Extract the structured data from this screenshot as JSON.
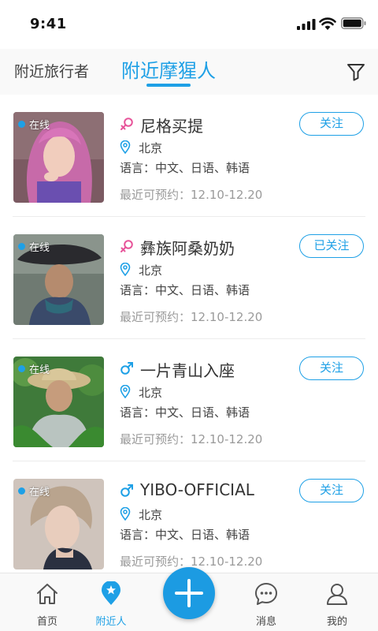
{
  "status_bar": {
    "time": "9:41"
  },
  "top_tabs": {
    "travelers": "附近旅行者",
    "guides": "附近摩猩人"
  },
  "colors": {
    "accent": "#1ea0e6",
    "female": "#e7559a",
    "male": "#1ea0e6"
  },
  "cards": [
    {
      "online": "在线",
      "gender": "female",
      "name": "尼格买提",
      "city": "北京",
      "languages": "语言：中文、日语、韩语",
      "availability": "最近可预约：12.10-12.20",
      "follow": "关注"
    },
    {
      "online": "在线",
      "gender": "female",
      "name": "彝族阿桑奶奶",
      "city": "北京",
      "languages": "语言：中文、日语、韩语",
      "availability": "最近可预约：12.10-12.20",
      "follow": "已关注"
    },
    {
      "online": "在线",
      "gender": "male",
      "name": "一片青山入座",
      "city": "北京",
      "languages": "语言：中文、日语、韩语",
      "availability": "最近可预约：12.10-12.20",
      "follow": "关注"
    },
    {
      "online": "在线",
      "gender": "male",
      "name": "YIBO-OFFICIAL",
      "city": "北京",
      "languages": "语言：中文、日语、韩语",
      "availability": "最近可预约：12.10-12.20",
      "follow": "关注"
    }
  ],
  "bottom_nav": {
    "home": "首页",
    "nearby": "附近人",
    "messages": "消息",
    "mine": "我的"
  },
  "icons": {
    "filter": "filter-icon",
    "location": "location-pin-icon",
    "female": "female-symbol-icon",
    "male": "male-symbol-icon",
    "home": "home-icon",
    "nearby": "nearby-pin-icon",
    "add": "plus-icon",
    "messages": "chat-bubble-icon",
    "mine": "user-icon"
  }
}
